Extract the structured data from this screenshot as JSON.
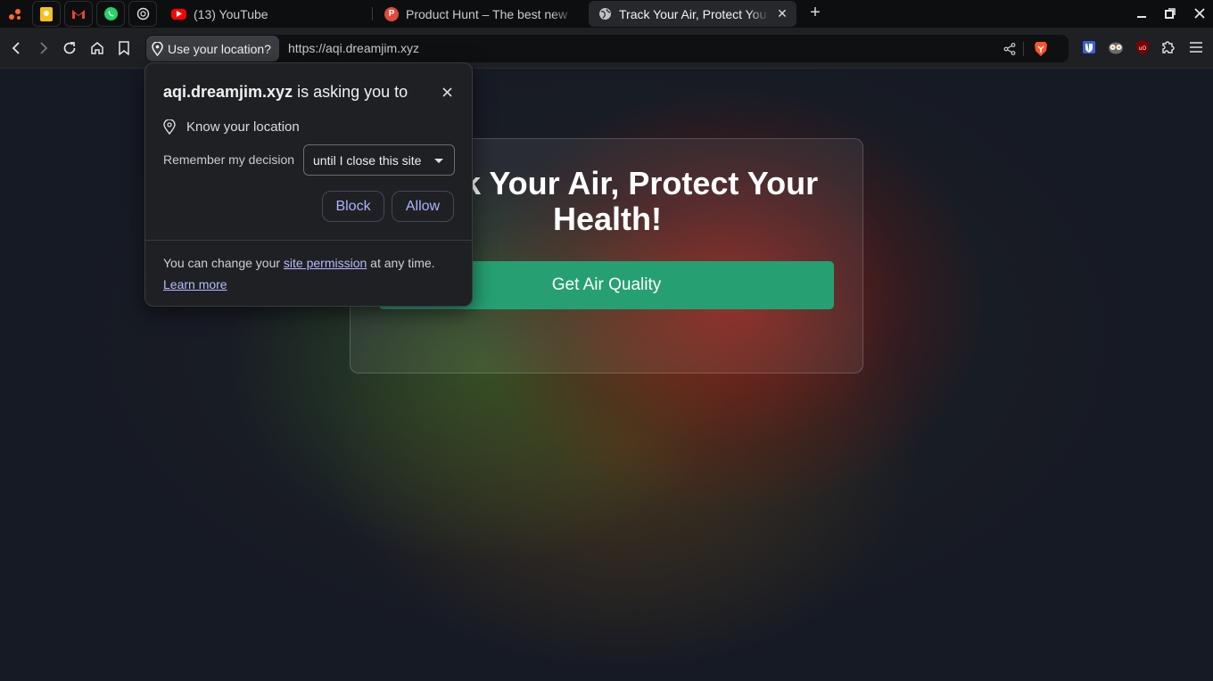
{
  "tabs": [
    {
      "title": "(13) YouTube",
      "favicon": "youtube-icon"
    },
    {
      "title": "Product Hunt – The best new",
      "favicon": "product-hunt-icon"
    },
    {
      "title": "Track Your Air, Protect You",
      "favicon": "globe-icon",
      "active": true
    }
  ],
  "pinned_tabs": [
    "app-icon",
    "keep-icon",
    "gmail-icon",
    "whatsapp-icon",
    "chatgpt-icon"
  ],
  "toolbar": {
    "permission_chip": "Use your location?",
    "url": "https://aqi.dreamjim.xyz"
  },
  "popup": {
    "site": "aqi.dreamjim.xyz",
    "asking_text": " is asking you to",
    "permission": "Know your location",
    "remember_label": "Remember my decision",
    "remember_value": "until I close this site",
    "block_label": "Block",
    "allow_label": "Allow",
    "footer_prefix": "You can change your ",
    "footer_link": "site permission",
    "footer_suffix": " at any time.",
    "learn_more": "Learn more"
  },
  "page": {
    "heading": "Track Your Air, Protect Your Health!",
    "cta_label": "Get Air Quality"
  },
  "colors": {
    "accent_button": "#26a073",
    "link": "#b4bcff",
    "tab_active": "#26282c"
  }
}
